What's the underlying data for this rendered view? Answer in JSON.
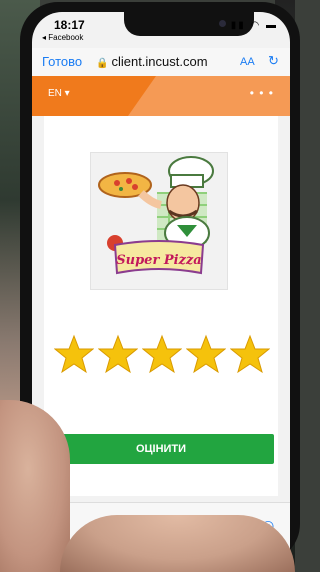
{
  "status_bar": {
    "time": "18:17",
    "back_app": "◂ Facebook"
  },
  "address_bar": {
    "done_label": "Готово",
    "url": "client.incust.com",
    "text_size_label": "AA"
  },
  "header": {
    "language": "EN ▾",
    "more_label": "• • •"
  },
  "logo": {
    "text": "Super Pizza"
  },
  "rating": {
    "value": 5,
    "max": 5
  },
  "rate_button": {
    "label": "ОЦІНИТИ"
  },
  "colors": {
    "header_orange": "#f07a1c",
    "button_green": "#22a540",
    "star_gold": "#f5c20c",
    "link_blue": "#1a7cf3"
  }
}
